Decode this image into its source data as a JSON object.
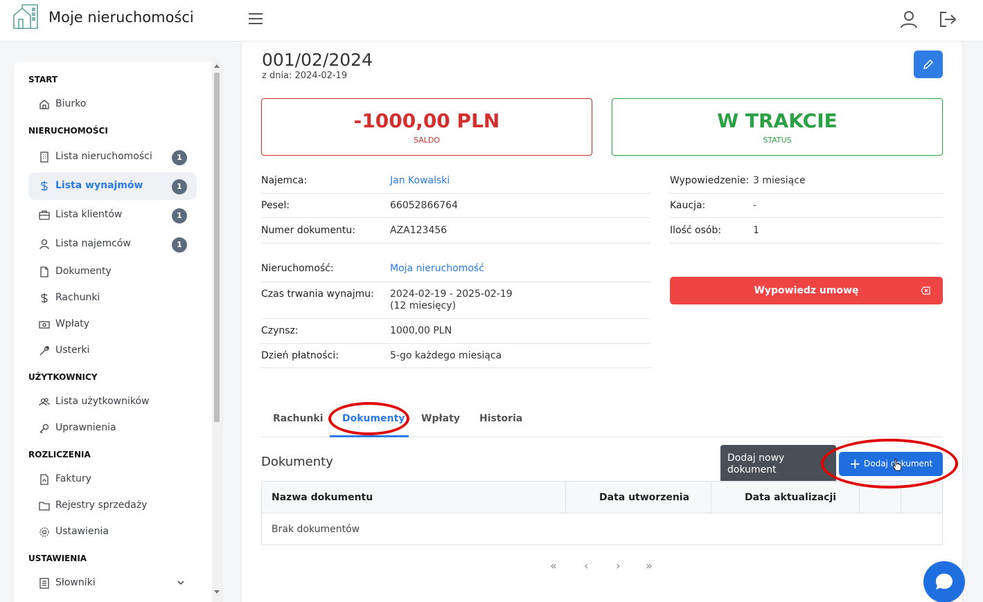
{
  "header": {
    "app_title": "Moje nieruchomości",
    "icons": {
      "logo": "building-logo-icon",
      "menu": "hamburger-icon",
      "user": "user-icon",
      "logout": "logout-icon"
    }
  },
  "sidebar": {
    "sections": {
      "start": "START",
      "properties": "NIERUCHOMOŚCI",
      "users": "UŻYTKOWNICY",
      "billing": "ROZLICZENIA",
      "settings": "USTAWIENIA"
    },
    "items": [
      {
        "label": "Biurko",
        "icon": "home-icon"
      },
      {
        "label": "Lista nieruchomości",
        "icon": "building-icon",
        "badge": "1"
      },
      {
        "label": "Lista wynajmów",
        "icon": "dollar-icon",
        "badge": "1",
        "active": true
      },
      {
        "label": "Lista klientów",
        "icon": "briefcase-icon",
        "badge": "1"
      },
      {
        "label": "Lista najemców",
        "icon": "user-icon",
        "badge": "1"
      },
      {
        "label": "Dokumenty",
        "icon": "file-icon"
      },
      {
        "label": "Rachunki",
        "icon": "dollar-icon"
      },
      {
        "label": "Wpłaty",
        "icon": "cash-icon"
      },
      {
        "label": "Usterki",
        "icon": "wrench-icon"
      },
      {
        "label": "Lista użytkowników",
        "icon": "users-icon"
      },
      {
        "label": "Uprawnienia",
        "icon": "key-icon"
      },
      {
        "label": "Faktury",
        "icon": "pdf-file-icon"
      },
      {
        "label": "Rejestry sprzedaży",
        "icon": "folder-icon"
      },
      {
        "label": "Ustawienia",
        "icon": "gear-icon"
      },
      {
        "label": "Słowniki",
        "icon": "book-icon"
      }
    ]
  },
  "rental": {
    "number": "001/02/2024",
    "date_line": "z dnia: 2024-02-19",
    "balance": {
      "value": "-1000,00 PLN",
      "label": "SALDO",
      "color": "#d32f2f"
    },
    "status": {
      "value": "W TRAKCIE",
      "label": "STATUS",
      "color": "#2aa145"
    },
    "left_details": [
      {
        "key": "Najemca:",
        "value": "Jan Kowalski"
      },
      {
        "key": "Pesel:",
        "value": "66052866764"
      },
      {
        "key": "Numer dokumentu:",
        "value": "AZA123456"
      }
    ],
    "left_details2": [
      {
        "key": "Nieruchomość:",
        "value": "Moja nieruchomość"
      },
      {
        "key": "Czas trwania wynajmu:",
        "value": "2024-02-19 - 2025-02-19",
        "value2": "(12 miesięcy)"
      },
      {
        "key": "Czynsz:",
        "value": "1000,00 PLN"
      },
      {
        "key": "Dzień płatności:",
        "value": "5-go każdego miesiąca"
      }
    ],
    "right_details": [
      {
        "key": "Wypowiedzenie:",
        "value": "3 miesiące"
      },
      {
        "key": "Kaucja:",
        "value": "-"
      },
      {
        "key": "Ilość osób:",
        "value": "1"
      }
    ],
    "terminate_label": "Wypowiedz umowę"
  },
  "tabs": [
    "Rachunki",
    "Dokumenty",
    "Wpłaty",
    "Historia"
  ],
  "active_tab": "Dokumenty",
  "documents": {
    "title": "Dokumenty",
    "tooltip": "Dodaj nowy dokument",
    "add_button": "Dodaj dokument",
    "columns": [
      "Nazwa dokumentu",
      "Data utworzenia",
      "Data aktualizacji"
    ],
    "empty_text": "Brak dokumentów"
  },
  "pager": [
    "«",
    "‹",
    "›",
    "»"
  ],
  "colors": {
    "primary": "#2a7be4",
    "danger": "#ee4444",
    "highlight": "#e00000"
  }
}
